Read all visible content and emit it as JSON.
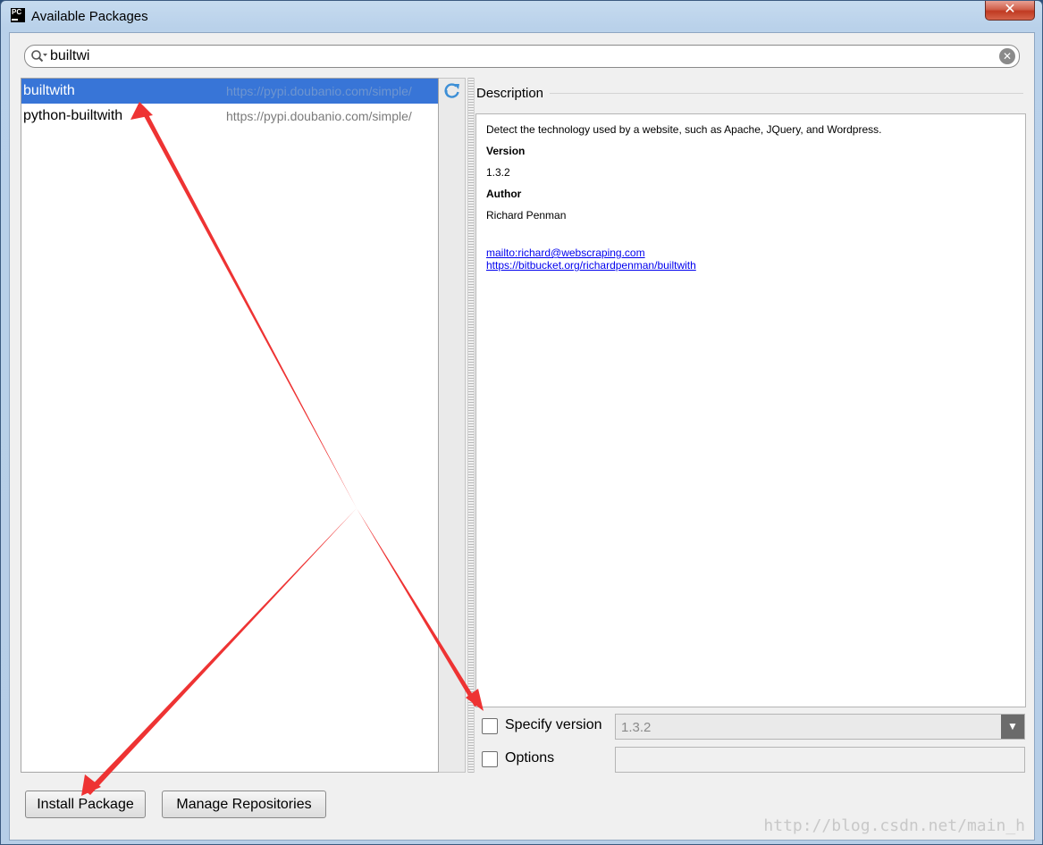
{
  "window": {
    "title": "Available Packages",
    "app_icon_text": "PC",
    "close_glyph": "✕"
  },
  "search": {
    "value": "builtwi",
    "clear_glyph": "✕"
  },
  "packages": [
    {
      "name": "builtwith",
      "url": "https://pypi.doubanio.com/simple/",
      "selected": true
    },
    {
      "name": "python-builtwith",
      "url": "https://pypi.doubanio.com/simple/",
      "selected": false
    }
  ],
  "description": {
    "heading": "Description",
    "summary": "Detect the technology used by a website, such as Apache, JQuery, and Wordpress.",
    "version_label": "Version",
    "version_value": "1.3.2",
    "author_label": "Author",
    "author_value": "Richard Penman",
    "links": [
      "mailto:richard@webscraping.com",
      "https://bitbucket.org/richardpenman/builtwith"
    ]
  },
  "specify_version": {
    "label": "Specify version",
    "checked": false,
    "value": "1.3.2"
  },
  "options": {
    "label": "Options",
    "checked": false,
    "value": ""
  },
  "buttons": {
    "install": "Install Package",
    "manage": "Manage Repositories"
  },
  "watermark": "http://blog.csdn.net/main_h",
  "colors": {
    "selection": "#3875d7",
    "annotation_arrow": "#ee3333",
    "link": "#0000ee"
  },
  "icons": [
    "search-icon",
    "refresh-icon",
    "clear-search-icon",
    "dropdown-arrow-icon",
    "close-icon"
  ]
}
